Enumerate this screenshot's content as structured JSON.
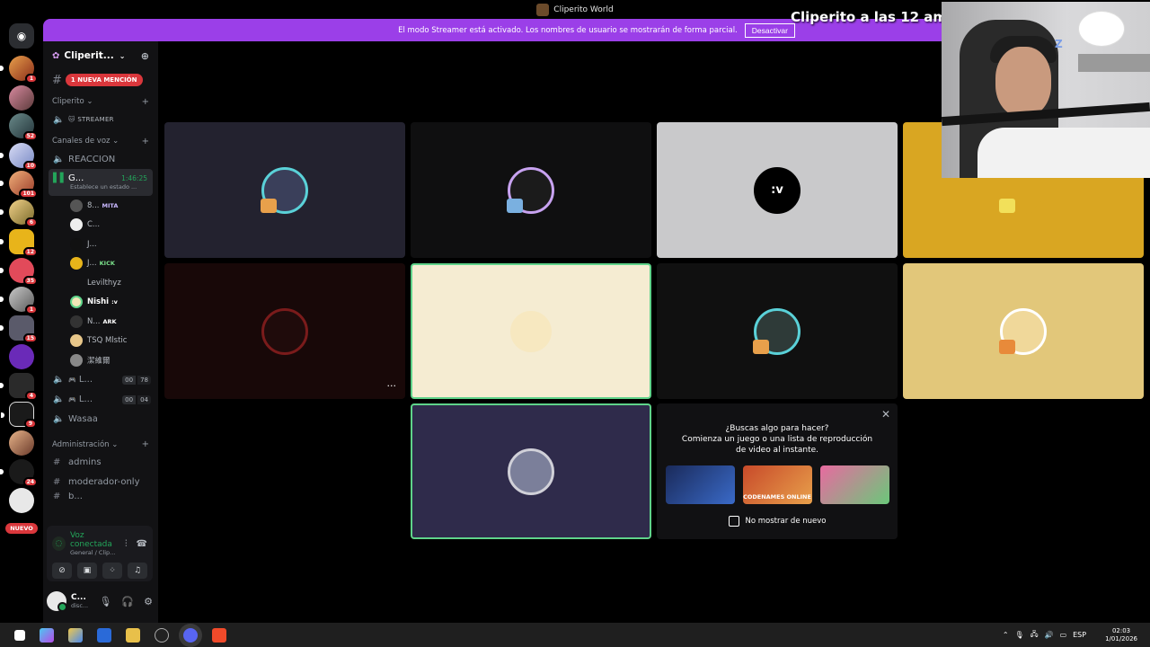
{
  "window": {
    "title": "Cliperito World"
  },
  "banner": {
    "text": "El modo Streamer está activado. Los nombres de usuario se mostrarán de forma parcial.",
    "button": "Desactivar"
  },
  "rail": {
    "badges": [
      "1",
      "",
      "52",
      "10",
      "101",
      "6",
      "12",
      "35",
      "1",
      "15",
      "",
      "4",
      "9",
      "",
      "24",
      ""
    ],
    "nuevo": "NUEVO"
  },
  "sidebar": {
    "server_name": "Cliperit...",
    "mention": "1 NUEVA MENCIÓN",
    "cat_cliperito": "Cliperito",
    "streamer_tag": "STREAMER",
    "cat_voice": "Canales de voz",
    "ch_reaccion": "REACCION",
    "active_channel": {
      "name": "G...",
      "timer": "1:46:25",
      "status": "Establece un estado ..."
    },
    "voice_users": [
      {
        "name": "8...",
        "tag": "MITA"
      },
      {
        "name": "C...",
        "tag": ""
      },
      {
        "name": "J...",
        "tag": ""
      },
      {
        "name": "J...",
        "tag": "KICK"
      },
      {
        "name": "Levilthyz",
        "tag": ""
      },
      {
        "name": "Nishi",
        "tag": ":v"
      },
      {
        "name": "N...",
        "tag": "ARK"
      },
      {
        "name": "TSQ Mlstic",
        "tag": ""
      },
      {
        "name": "潔維爾",
        "tag": ""
      }
    ],
    "ch_l1": {
      "name": "L...",
      "a": "00",
      "b": "78"
    },
    "ch_l2": {
      "name": "L...",
      "a": "00",
      "b": "04"
    },
    "ch_wasaa": "Wasaa",
    "cat_admin": "Administración",
    "ch_admins": "admins",
    "ch_mod": "moderador-only",
    "ch_cut": "b...",
    "voice_connected": "Voz conectada",
    "voice_sub": "General / Clip...",
    "user_name": "C...",
    "user_sub": "disc..."
  },
  "tiles": [
    {
      "bg": "#23222f",
      "av": "#3a3f5a",
      "ring": "#5ad1d8"
    },
    {
      "bg": "#0f0f10",
      "av": "#1b1b1b",
      "ring": "#c7a2f0"
    },
    {
      "bg": "#c9c9cb",
      "av": "#000000",
      "ring": "#000000",
      "text": ":v"
    },
    {
      "bg": "#d9a622",
      "av": "#d9a622",
      "ring": "#d9a622"
    },
    {
      "bg": "#180808",
      "av": "#1f0b0b",
      "ring": "#7a1b1b"
    },
    {
      "bg": "#f5ecd2",
      "av": "#f7e8c0",
      "ring": "#f5ecd2"
    },
    {
      "bg": "#101010",
      "av": "#2e3a38",
      "ring": "#5ad1d8"
    },
    {
      "bg": "#e2c77a",
      "av": "#f0d89a",
      "ring": "#ffffff"
    },
    {
      "bg": "#2f2b4b",
      "av": "#7b7f9a",
      "ring": "#d0d0d8"
    }
  ],
  "activity": {
    "title": "¿Buscas algo para hacer?",
    "subtitle": "Comienza un juego o una lista de reproducción de video al instante.",
    "games": [
      "",
      "CODENAMES ONLINE",
      ""
    ],
    "no_show": "No mostrar de nuevo"
  },
  "overlay": {
    "text": "Cliperito a las 12 am"
  },
  "taskbar": {
    "lang": "ESP",
    "time": "02:03",
    "date": "1/01/2026"
  }
}
